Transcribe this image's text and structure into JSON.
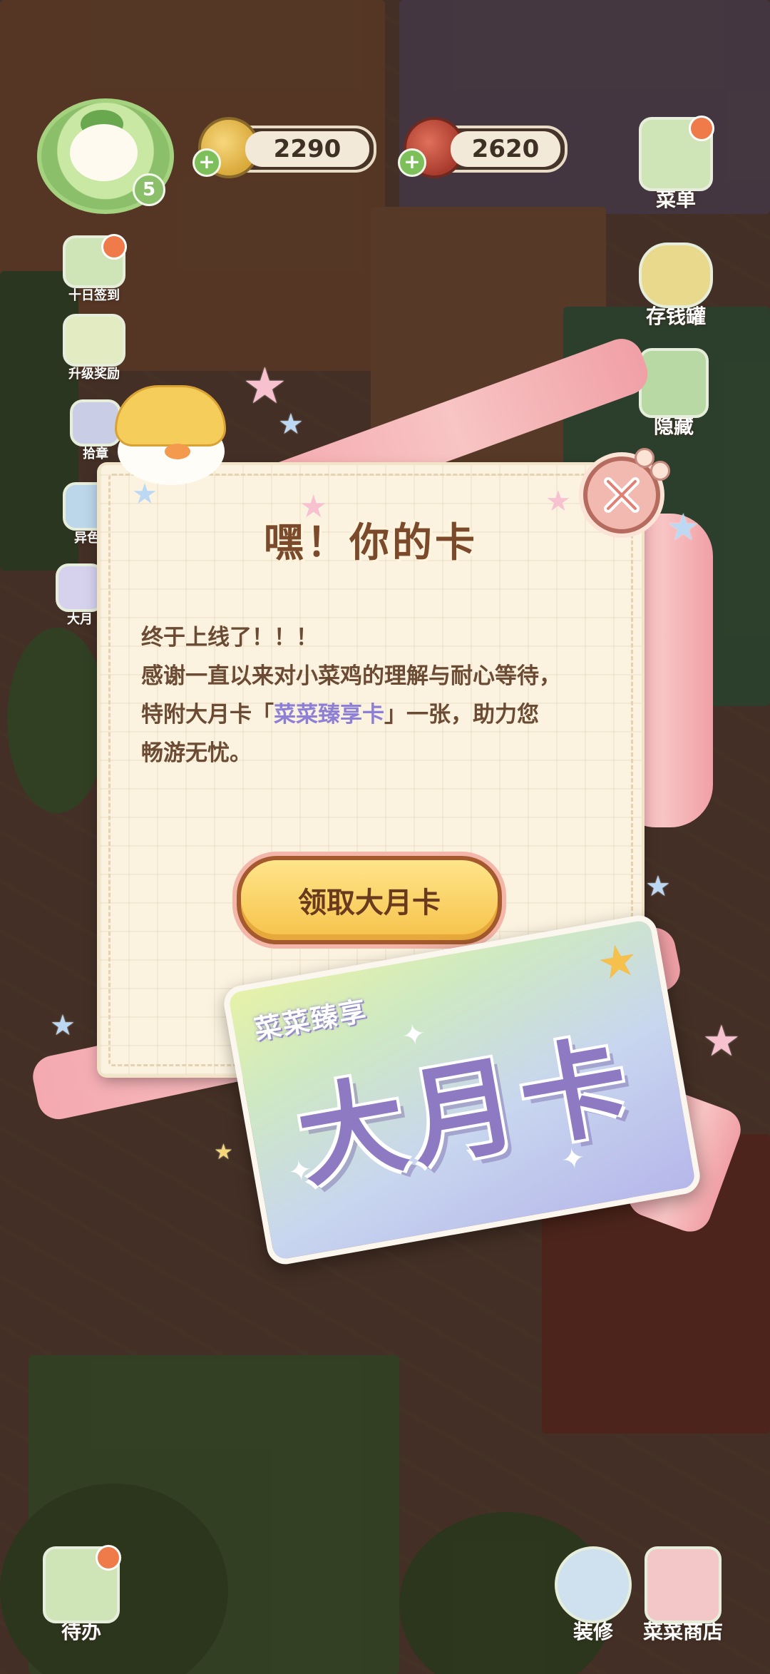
{
  "hud": {
    "level": "5",
    "coins": "2290",
    "tomatoes": "2620"
  },
  "left_menu": [
    {
      "label": "十日签到",
      "icon": "calendar-icon"
    },
    {
      "label": "升级奖励",
      "icon": "gift-icon"
    },
    {
      "label": "拾章",
      "icon": "stamp-icon"
    },
    {
      "label": "异色",
      "icon": "palette-icon"
    },
    {
      "label": "大月",
      "icon": "month-card-icon"
    }
  ],
  "right_menu": [
    {
      "label": "菜单",
      "icon": "menu-board-icon"
    },
    {
      "label": "存钱罐",
      "icon": "piggy-bank-icon"
    },
    {
      "label": "隐藏",
      "icon": "hide-icon"
    }
  ],
  "bottom_left": {
    "label": "待办",
    "icon": "todo-list-icon"
  },
  "bottom_right": [
    {
      "label": "装修",
      "icon": "decorate-icon"
    },
    {
      "label": "菜菜商店",
      "icon": "shop-icon"
    }
  ],
  "dialog": {
    "title": "嘿！你的卡",
    "line1": "终于上线了！！！",
    "line2": "感谢一直以来对小菜鸡的理解与耐心等待，",
    "line3_pre": "特附大月卡「",
    "line3_highlight": "菜菜臻享卡",
    "line3_post": "」一张，助力您",
    "line4": "畅游无忧。",
    "claim_button": "领取大月卡"
  },
  "card": {
    "subtitle": "菜菜臻享",
    "title": "大月卡"
  },
  "colors": {
    "dialog_bg": "#fbf2df",
    "title_brown": "#7a4a2a",
    "highlight_purple": "#8d7fd6",
    "button_yellow": "#f6c24a",
    "ribbon_pink": "#f4a9b0"
  }
}
